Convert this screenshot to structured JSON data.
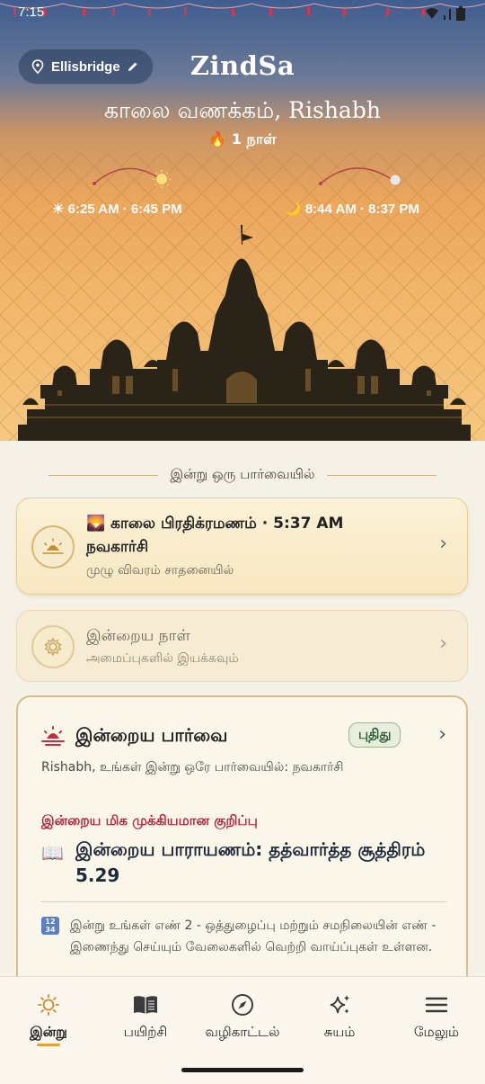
{
  "status_bar": {
    "time": "7:15"
  },
  "header": {
    "location": "Ellisbridge",
    "app_title": "ZindSa",
    "greeting": "காலை வணக்கம், Rishabh",
    "streak": "🔥 1 நாள்",
    "sun_times": "☀ 6:25 AM · 6:45 PM",
    "moon_times": "🌙 8:44 AM · 8:37 PM"
  },
  "section_title": "இன்று ஒரு பார்வையில்",
  "cards": {
    "pratikraman": {
      "title": "🌄 காலை பிரதிக்ரமணம் · 5:37 AM",
      "subtitle": "நவகார்சி",
      "hint": "முழு விவரம் சாதனையில்"
    },
    "today_day": {
      "title": "இன்றைய நாள்",
      "hint": "அமைப்புகளில் இயக்கவும்"
    },
    "today_view": {
      "title": "இன்றைய பார்வை",
      "badge": "புதிது",
      "body": "Rishabh, உங்கள் இன்று ஒரே பார்வையில்: நவகார்சி",
      "important": "இன்றைய மிக முக்கியமான குறிப்பு",
      "reading_icon": "📖",
      "reading": "இன்றைய பாராயணம்: தத்வார்த்த சூத்திரம் 5.29",
      "number_text": "இன்று உங்கள் எண் 2 - ஒத்துழைப்பு மற்றும் சமநிலையின் எண் - இணைந்து செய்யும் வேலைகளில் வெற்றி வாய்ப்புகள் உள்ளன."
    }
  },
  "nav": {
    "items": [
      {
        "label": "இன்று",
        "icon": "sun-icon",
        "active": true
      },
      {
        "label": "பயிற்சி",
        "icon": "book-icon",
        "active": false
      },
      {
        "label": "வழிகாட்டல்",
        "icon": "compass-icon",
        "active": false
      },
      {
        "label": "சுயம்",
        "icon": "sparkles-icon",
        "active": false
      },
      {
        "label": "மேலும்",
        "icon": "menu-icon",
        "active": false
      }
    ]
  },
  "colors": {
    "accent": "#e0a33c",
    "important_red": "#b0283b",
    "badge_green": "#2f5a33"
  }
}
